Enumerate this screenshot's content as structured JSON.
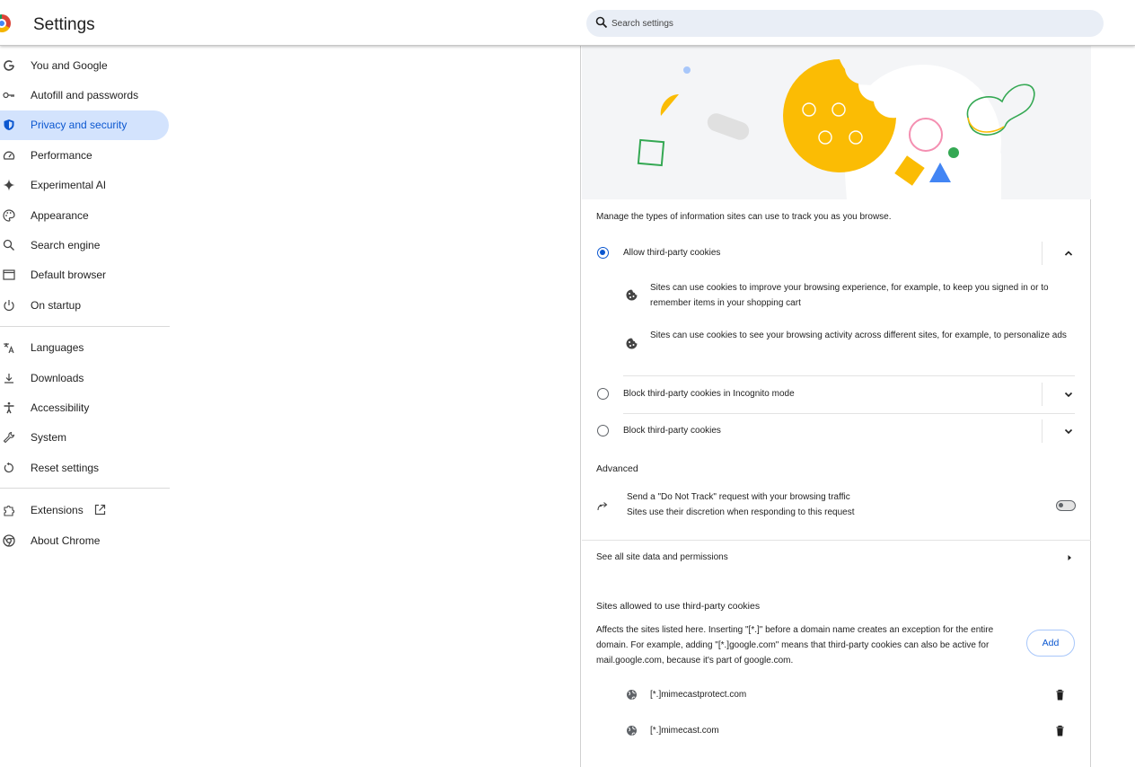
{
  "app": {
    "title": "Settings"
  },
  "search": {
    "placeholder": "Search settings"
  },
  "sidebar": {
    "items": [
      {
        "label": "You and Google",
        "icon": "google-g-icon"
      },
      {
        "label": "Autofill and passwords",
        "icon": "key-icon"
      },
      {
        "label": "Privacy and security",
        "icon": "shield-icon",
        "active": true
      },
      {
        "label": "Performance",
        "icon": "speedometer-icon"
      },
      {
        "label": "Experimental AI",
        "icon": "sparkle-icon"
      },
      {
        "label": "Appearance",
        "icon": "palette-icon"
      },
      {
        "label": "Search engine",
        "icon": "search-icon"
      },
      {
        "label": "Default browser",
        "icon": "browser-window-icon"
      },
      {
        "label": "On startup",
        "icon": "power-icon"
      },
      {
        "label": "Languages",
        "icon": "translate-icon"
      },
      {
        "label": "Downloads",
        "icon": "download-icon"
      },
      {
        "label": "Accessibility",
        "icon": "accessibility-icon"
      },
      {
        "label": "System",
        "icon": "wrench-icon"
      },
      {
        "label": "Reset settings",
        "icon": "reset-icon"
      },
      {
        "label": "Extensions",
        "icon": "puzzle-icon"
      },
      {
        "label": "About Chrome",
        "icon": "chrome-icon"
      }
    ]
  },
  "cookies": {
    "intro": "Manage the types of information sites can use to track you as you browse.",
    "options": [
      {
        "label": "Allow third-party cookies",
        "selected": true,
        "expanded": true
      },
      {
        "label": "Block third-party cookies in Incognito mode",
        "selected": false,
        "expanded": false
      },
      {
        "label": "Block third-party cookies",
        "selected": false,
        "expanded": false
      }
    ],
    "details": [
      "Sites can use cookies to improve your browsing experience, for example, to keep you signed in or to remember items in your shopping cart",
      "Sites can use cookies to see your browsing activity across different sites, for example, to personalize ads"
    ]
  },
  "advanced": {
    "heading": "Advanced",
    "dnt_title": "Send a \"Do Not Track\" request with your browsing traffic",
    "dnt_subtitle": "Sites use their discretion when responding to this request",
    "dnt_enabled": false
  },
  "site_data": {
    "label": "See all site data and permissions"
  },
  "allowed_sites": {
    "heading": "Sites allowed to use third-party cookies",
    "description": "Affects the sites listed here. Inserting \"[*.]\" before a domain name creates an exception for the entire domain. For example, adding \"[*.]google.com\" means that third-party cookies can also be active for mail.google.com, because it's part of google.com.",
    "add_label": "Add",
    "sites": [
      "[*.]mimecastprotect.com",
      "[*.]mimecast.com"
    ]
  },
  "colors": {
    "accent": "#0b57d0",
    "active_bg": "#d3e3fd",
    "search_bg": "#e9eef6",
    "cookie_yellow": "#fbbc04"
  }
}
